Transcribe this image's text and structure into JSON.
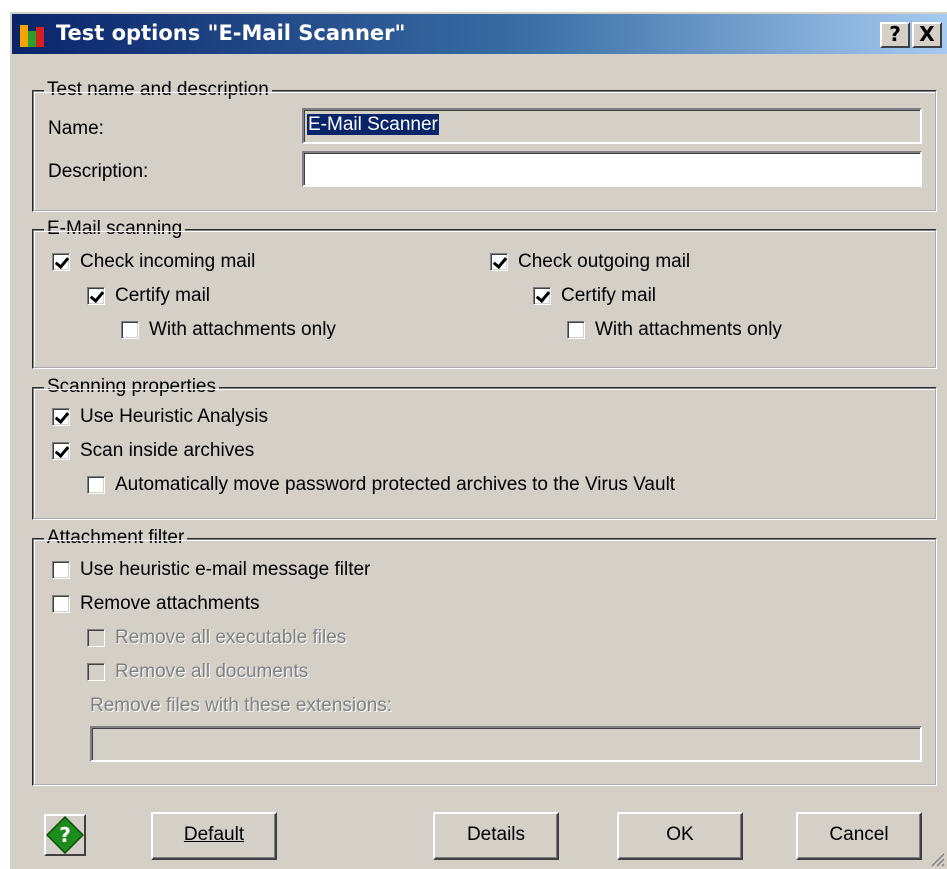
{
  "window": {
    "title": "Test options \"E-Mail Scanner\"",
    "help_glyph": "?",
    "close_glyph": "X"
  },
  "test_group": {
    "legend": "Test name and description",
    "name_label": "Name:",
    "name_value": "E-Mail Scanner",
    "description_label": "Description:",
    "description_value": ""
  },
  "email_group": {
    "legend": "E-Mail scanning",
    "incoming": {
      "label": "Check incoming mail",
      "checked": true,
      "certify": {
        "label": "Certify mail",
        "checked": true
      },
      "attachments_only": {
        "label": "With attachments only",
        "checked": false
      }
    },
    "outgoing": {
      "label": "Check outgoing mail",
      "checked": true,
      "certify": {
        "label": "Certify mail",
        "checked": true
      },
      "attachments_only": {
        "label": "With attachments only",
        "checked": false
      }
    }
  },
  "scan_group": {
    "legend": "Scanning properties",
    "heuristic": {
      "label": "Use Heuristic Analysis",
      "checked": true
    },
    "archives": {
      "label": "Scan inside archives",
      "checked": true
    },
    "move_protected": {
      "label": "Automatically move password protected archives to the Virus Vault",
      "checked": false
    }
  },
  "attach_group": {
    "legend": "Attachment filter",
    "heuristic_filter": {
      "label": "Use heuristic e-mail message filter",
      "checked": false
    },
    "remove_attachments": {
      "label": "Remove attachments",
      "checked": false
    },
    "remove_executables": {
      "label": "Remove all executable files",
      "checked": false,
      "enabled": false
    },
    "remove_documents": {
      "label": "Remove all documents",
      "checked": false,
      "enabled": false
    },
    "extensions_label": "Remove files with these extensions:",
    "extensions_value": ""
  },
  "buttons": {
    "default": "Default",
    "details": "Details",
    "ok": "OK",
    "cancel": "Cancel"
  },
  "colors": {
    "titlebar_start": "#0a246a",
    "titlebar_end": "#a6caf0",
    "face": "#d4d0c8",
    "help_green": "#1c8c1c"
  }
}
